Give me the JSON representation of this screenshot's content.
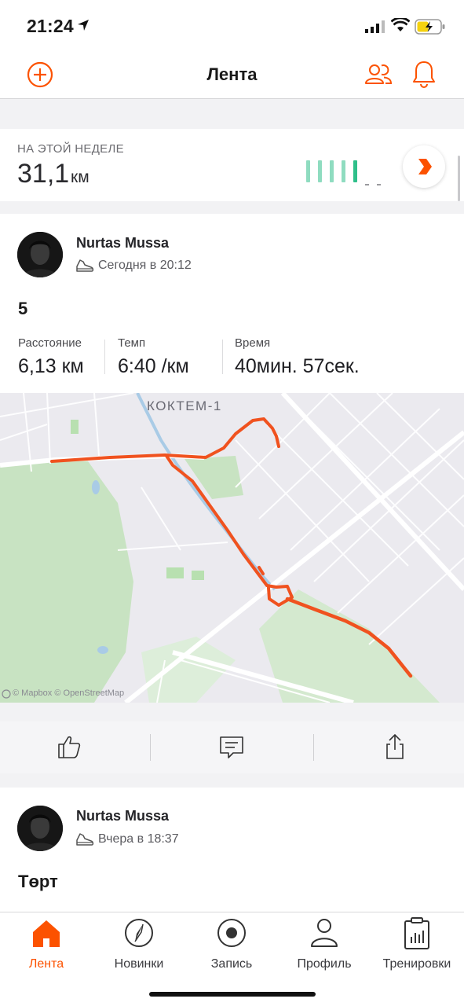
{
  "status_bar": {
    "time": "21:24"
  },
  "navbar": {
    "title": "Лента"
  },
  "weekly": {
    "label": "НА ЭТОЙ НЕДЕЛЕ",
    "value": "31,1",
    "unit": "км"
  },
  "colors": {
    "brand": "#fc5200",
    "route": "#f0521f",
    "bar_light": "#8fdcc0",
    "bar_current": "#2fbf8a"
  },
  "activities": [
    {
      "athlete": "Nurtas Mussa",
      "time": "Сегодня в 20:12",
      "title": "5",
      "stats": [
        {
          "label": "Расстояние",
          "value": "6,13 км"
        },
        {
          "label": "Темп",
          "value": "6:40 /км"
        },
        {
          "label": "Время",
          "value": "40мин. 57сек."
        }
      ],
      "map": {
        "area_label": "КОКТЕМ-1",
        "attribution": "© Mapbox © OpenStreetMap"
      }
    },
    {
      "athlete": "Nurtas Mussa",
      "time": "Вчера в 18:37",
      "title": "Төрт"
    }
  ],
  "tabs": [
    {
      "label": "Лента",
      "icon": "home-icon",
      "active": true
    },
    {
      "label": "Новинки",
      "icon": "compass-icon",
      "active": false
    },
    {
      "label": "Запись",
      "icon": "record-icon",
      "active": false
    },
    {
      "label": "Профиль",
      "icon": "profile-icon",
      "active": false
    },
    {
      "label": "Тренировки",
      "icon": "training-log-icon",
      "active": false
    }
  ]
}
